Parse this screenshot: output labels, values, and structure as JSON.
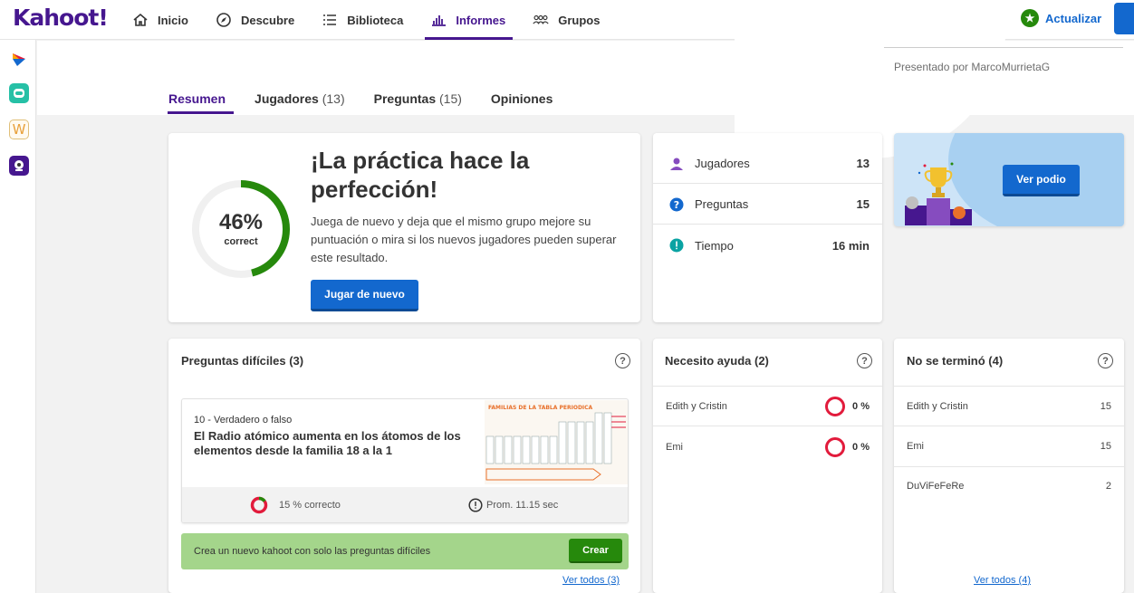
{
  "brand": {
    "logo": "Kahoot!"
  },
  "nav": {
    "items": [
      {
        "label": "Inicio",
        "icon": "home-icon"
      },
      {
        "label": "Descubre",
        "icon": "compass-icon"
      },
      {
        "label": "Biblioteca",
        "icon": "list-icon"
      },
      {
        "label": "Informes",
        "icon": "bar-chart-icon"
      },
      {
        "label": "Grupos",
        "icon": "groups-icon"
      }
    ],
    "active": "Informes",
    "upgrade_label": "Actualizar"
  },
  "header": {
    "presented_by": "Presentado por MarcoMurrietaG",
    "tabs": [
      {
        "label": "Resumen",
        "count": ""
      },
      {
        "label": "Jugadores",
        "count": "(13)"
      },
      {
        "label": "Preguntas",
        "count": "(15)"
      },
      {
        "label": "Opiniones",
        "count": ""
      }
    ]
  },
  "summary": {
    "percent": "46%",
    "percent_value": 46,
    "percent_sub": "correct",
    "headline": "¡La práctica hace la perfección!",
    "description": "Juega de nuevo y deja que el mismo grupo mejore su puntuación o mira si los nuevos jugadores pueden superar este resultado.",
    "play_again": "Jugar de nuevo"
  },
  "stats": {
    "players_label": "Jugadores",
    "players_value": "13",
    "questions_label": "Preguntas",
    "questions_value": "15",
    "time_label": "Tiempo",
    "time_value": "16 min"
  },
  "podium": {
    "button": "Ver podio"
  },
  "difficult": {
    "title": "Preguntas difíciles (3)",
    "question_type": "10 - Verdadero o falso",
    "question_text": "El Radio atómico aumenta en los átomos de los elementos desde la familia 18 a la 1",
    "image_title": "FAMILIAS DE LA TABLA PERIODICA",
    "correct": "15 % correcto",
    "correct_value": 15,
    "avg_time": "Prom. 11.15 sec",
    "new_kahoot_text": "Crea un nuevo kahoot con solo las preguntas difíciles",
    "create_button": "Crear",
    "see_all": "Ver todos (3)"
  },
  "help": {
    "title": "Necesito ayuda (2)",
    "rows": [
      {
        "name": "Edith y Cristin",
        "pct": "0 %"
      },
      {
        "name": "Emi",
        "pct": "0 %"
      }
    ]
  },
  "unfinished": {
    "title": "No se terminó (4)",
    "rows": [
      {
        "name": "Edith y Cristin",
        "value": "15"
      },
      {
        "name": "Emi",
        "value": "15"
      },
      {
        "name": "DuViFeFeRe",
        "value": "2"
      }
    ],
    "see_all": "Ver todos (4)"
  },
  "colors": {
    "brand_purple": "#46178f",
    "primary_blue": "#1368ce",
    "success_green": "#26890c",
    "danger_red": "#e21b3c"
  }
}
